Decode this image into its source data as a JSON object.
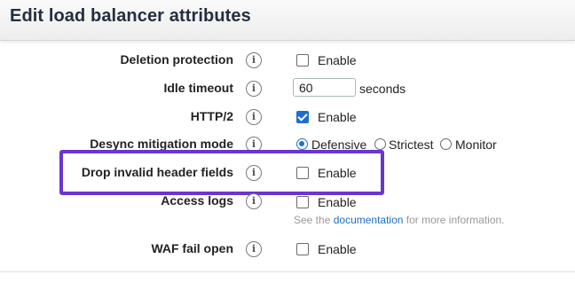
{
  "header": {
    "title": "Edit load balancer attributes"
  },
  "info_glyph": "i",
  "rows": {
    "deletion_protection": {
      "label": "Deletion protection",
      "option": "Enable",
      "checked": false
    },
    "idle_timeout": {
      "label": "Idle timeout",
      "value": "60",
      "unit": "seconds"
    },
    "http2": {
      "label": "HTTP/2",
      "option": "Enable",
      "checked": true
    },
    "desync": {
      "label": "Desync mitigation mode",
      "options": [
        "Defensive",
        "Strictest",
        "Monitor"
      ],
      "selected": "Defensive"
    },
    "drop_invalid": {
      "label": "Drop invalid header fields",
      "option": "Enable",
      "checked": false
    },
    "access_logs": {
      "label": "Access logs",
      "option": "Enable",
      "checked": false,
      "note_prefix": "See the",
      "note_link": "documentation",
      "note_suffix": "for more information."
    },
    "waf_fail_open": {
      "label": "WAF fail open",
      "option": "Enable",
      "checked": false
    }
  },
  "colors": {
    "accent": "#1a6fd1",
    "highlight": "#6a35d1",
    "link": "#1a6ec6"
  }
}
